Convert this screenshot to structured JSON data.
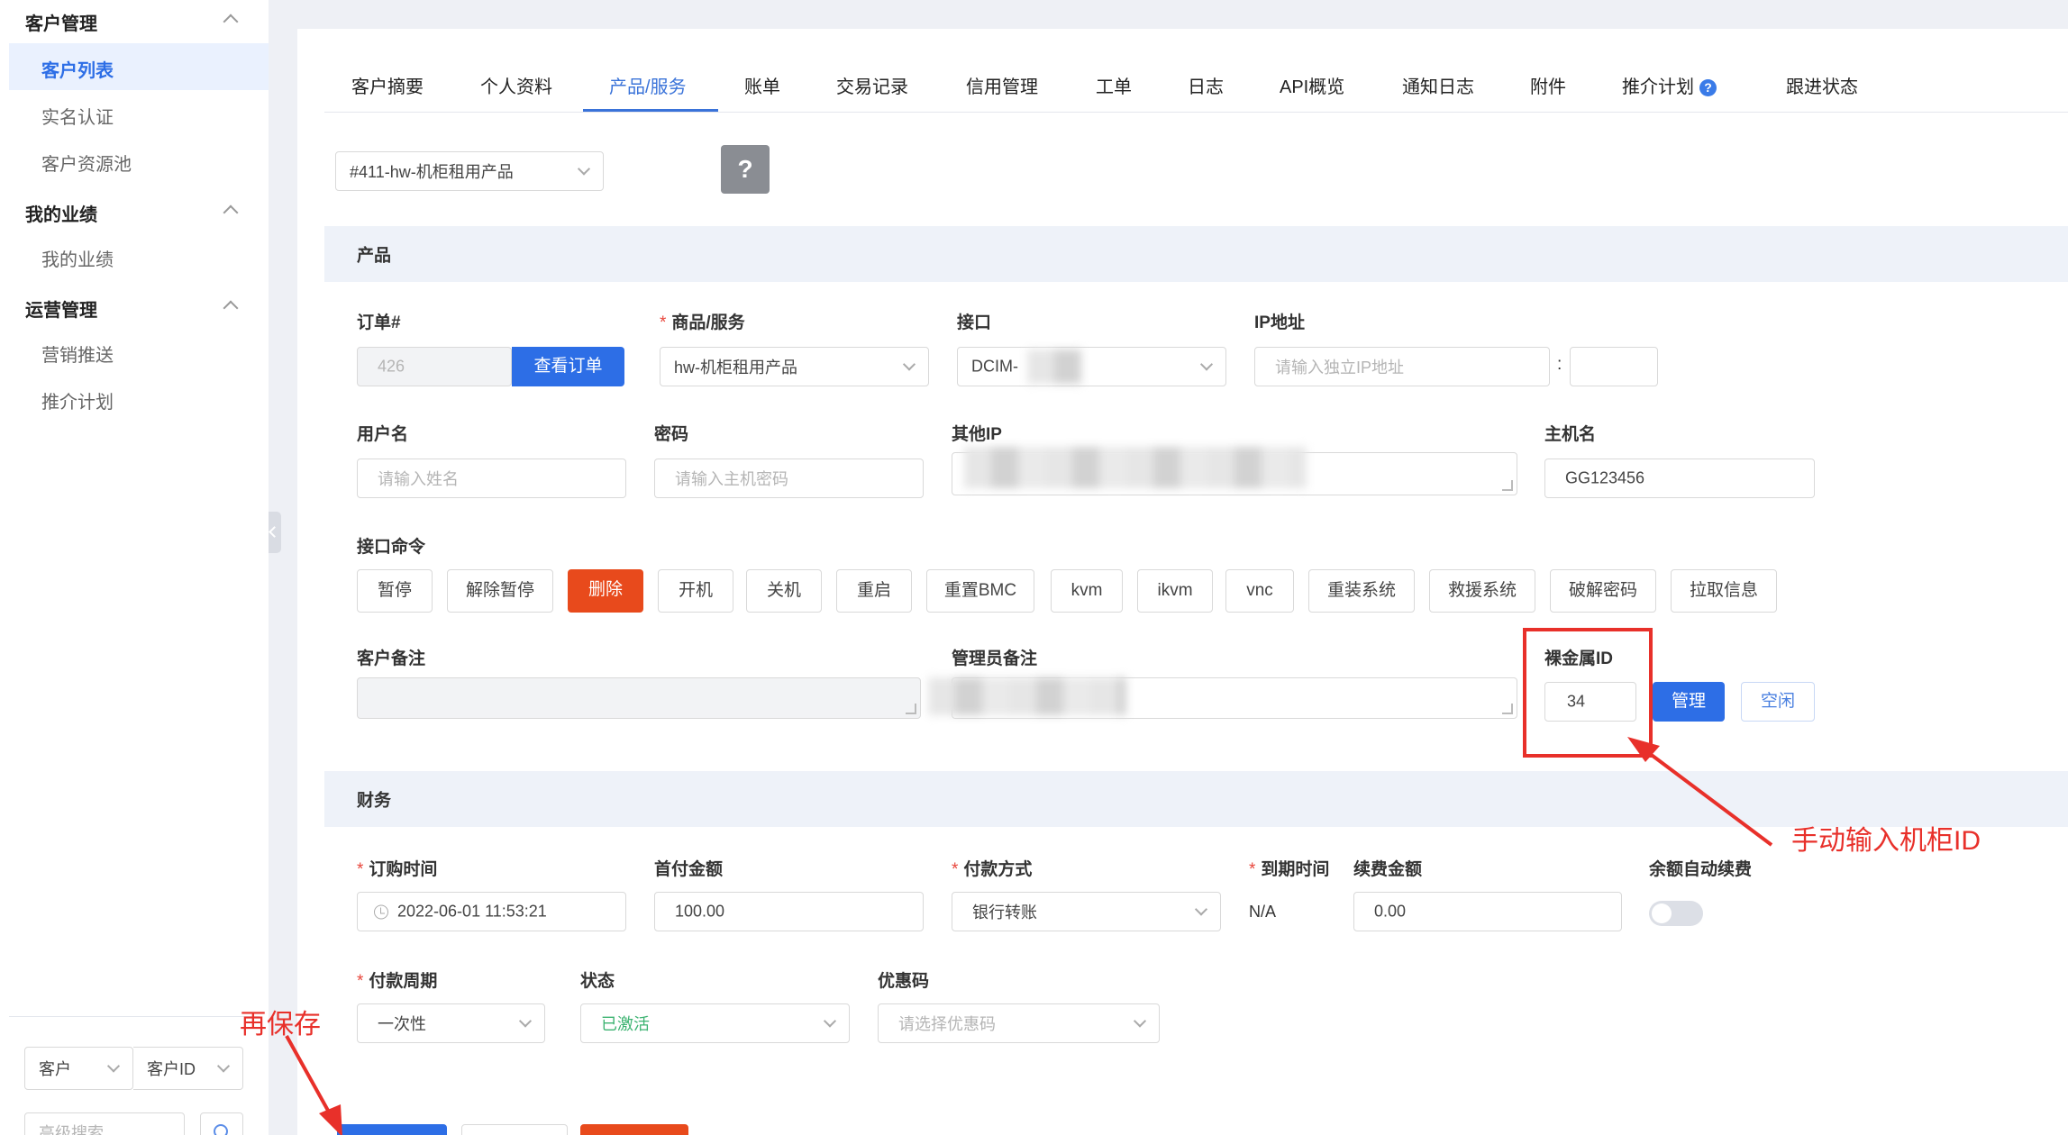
{
  "sidebar": {
    "groups": [
      {
        "label": "客户管理",
        "items": [
          "客户列表",
          "实名认证",
          "客户资源池"
        ]
      },
      {
        "label": "我的业绩",
        "items": [
          "我的业绩"
        ]
      },
      {
        "label": "运营管理",
        "items": [
          "营销推送",
          "推介计划"
        ]
      }
    ],
    "active_item": "客户列表",
    "search": {
      "type_select": "客户",
      "field_select": "客户ID",
      "input_placeholder": "高级搜索"
    }
  },
  "tabs": [
    "客户摘要",
    "个人资料",
    "产品/服务",
    "账单",
    "交易记录",
    "信用管理",
    "工单",
    "日志",
    "API概览",
    "通知日志",
    "附件",
    "推介计划",
    "跟进状态"
  ],
  "active_tab": "产品/服务",
  "product_selector": "#411-hw-机柜租用产品",
  "help_button": "?",
  "product_section": {
    "title": "产品",
    "order_label": "订单#",
    "order_value": "426",
    "view_order_button": "查看订单",
    "service_label": "商品/服务",
    "service_value": "hw-机柜租用产品",
    "interface_label": "接口",
    "interface_value": "DCIM-",
    "ip_label": "IP地址",
    "ip_placeholder": "请输入独立IP地址",
    "ip_separator": ":",
    "username_label": "用户名",
    "username_placeholder": "请输入姓名",
    "password_label": "密码",
    "password_placeholder": "请输入主机密码",
    "other_ip_label": "其他IP",
    "hostname_label": "主机名",
    "hostname_value": "GG123456",
    "commands_label": "接口命令",
    "commands": [
      "暂停",
      "解除暂停",
      "删除",
      "开机",
      "关机",
      "重启",
      "重置BMC",
      "kvm",
      "ikvm",
      "vnc",
      "重装系统",
      "救援系统",
      "破解密码",
      "拉取信息"
    ],
    "customer_note_label": "客户备注",
    "admin_note_label": "管理员备注",
    "bare_metal_label": "裸金属ID",
    "bare_metal_value": "34",
    "manage_button": "管理",
    "idle_button": "空闲"
  },
  "finance_section": {
    "title": "财务",
    "order_time_label": "订购时间",
    "order_time_value": "2022-06-01 11:53:21",
    "first_amount_label": "首付金额",
    "first_amount_value": "100.00",
    "payment_method_label": "付款方式",
    "payment_method_value": "银行转账",
    "due_label": "到期时间",
    "due_value": "N/A",
    "renew_amount_label": "续费金额",
    "renew_amount_value": "0.00",
    "auto_renew_label": "余额自动续费",
    "auto_renew_on": false,
    "cycle_label": "付款周期",
    "cycle_value": "一次性",
    "status_label": "状态",
    "status_value": "已激活",
    "coupon_label": "优惠码",
    "coupon_placeholder": "请选择优惠码"
  },
  "annotations": {
    "cabinet_note": "手动输入机柜ID",
    "save_note": "再保存"
  },
  "colors": {
    "primary": "#2d6ee6",
    "danger": "#e84a1c",
    "annotation": "#e8302a",
    "status_active": "#3cb371"
  }
}
